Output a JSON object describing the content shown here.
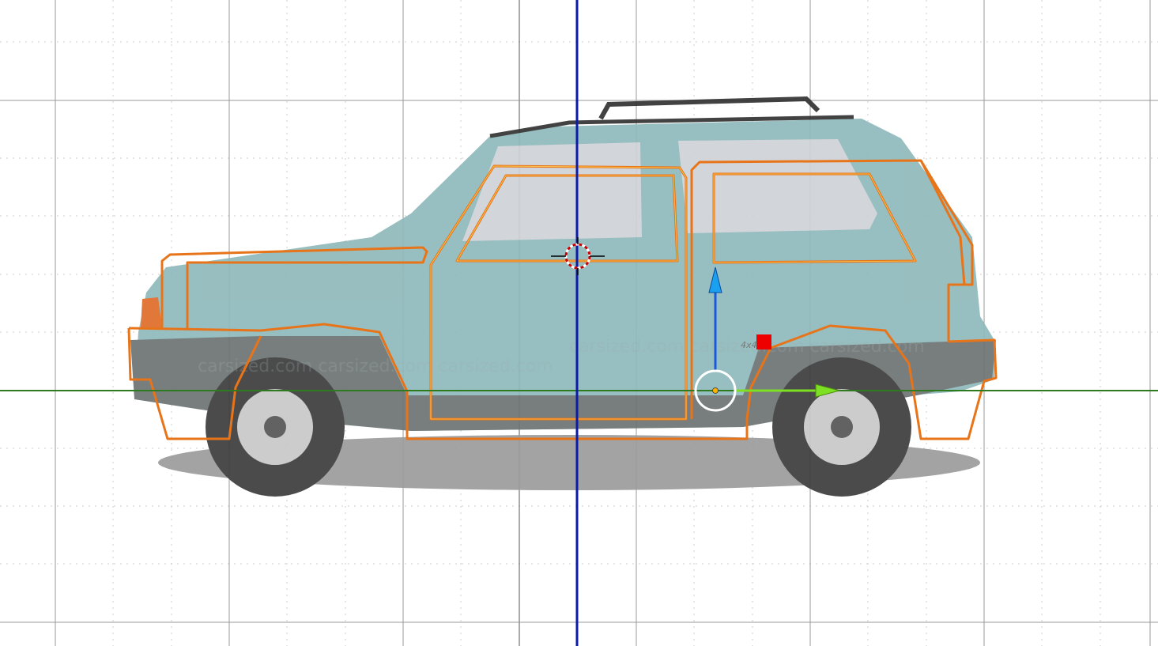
{
  "viewport": {
    "watermark": "carsized.com carsized.com carsized.com",
    "badge": "4x4",
    "colors": {
      "x_axis": "#2d7a1f",
      "z_axis": "#0b1aa8",
      "outline": "#e8741a",
      "body": "#8fb9bb",
      "gizmo_x": "#7de022",
      "gizmo_z": "#1aa0f0",
      "handle": "#ee0000"
    }
  }
}
